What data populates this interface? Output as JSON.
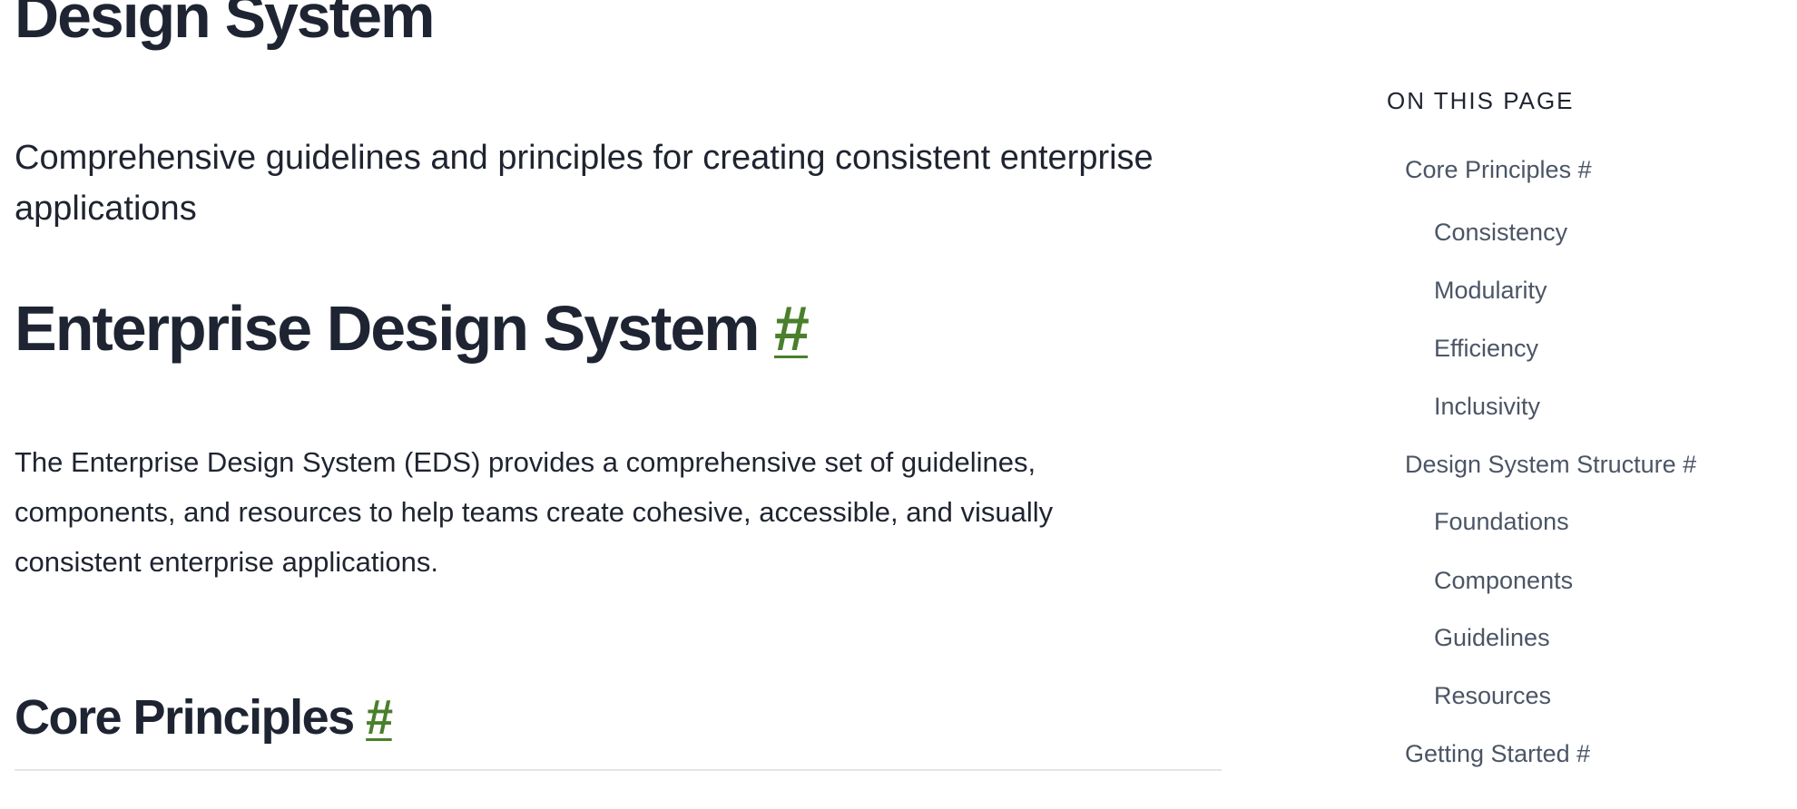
{
  "page": {
    "title": "Design System",
    "lead": "Comprehensive guidelines and principles for creating consistent enterprise applications"
  },
  "sections": {
    "enterprise": {
      "heading": "Enterprise Design System",
      "anchor": "#",
      "body": "The Enterprise Design System (EDS) provides a comprehensive set of guidelines, components, and resources to help teams create cohesive, accessible, and visually consistent enterprise applications."
    },
    "core": {
      "heading": "Core Principles",
      "anchor": "#"
    }
  },
  "toc": {
    "heading": "ON THIS PAGE",
    "items": [
      {
        "label": "Core Principles #",
        "level": 1
      },
      {
        "label": "Consistency",
        "level": 2
      },
      {
        "label": "Modularity",
        "level": 2
      },
      {
        "label": "Efficiency",
        "level": 2
      },
      {
        "label": "Inclusivity",
        "level": 2
      },
      {
        "label": "Design System Structure #",
        "level": 1
      },
      {
        "label": "Foundations",
        "level": 2
      },
      {
        "label": "Components",
        "level": 2
      },
      {
        "label": "Guidelines",
        "level": 2
      },
      {
        "label": "Resources",
        "level": 2
      },
      {
        "label": "Getting Started #",
        "level": 1
      }
    ]
  },
  "colors": {
    "heading": "#1e2432",
    "anchor": "#4a7f2c",
    "toc_link": "#4b5565",
    "divider": "#e3e6ea"
  }
}
